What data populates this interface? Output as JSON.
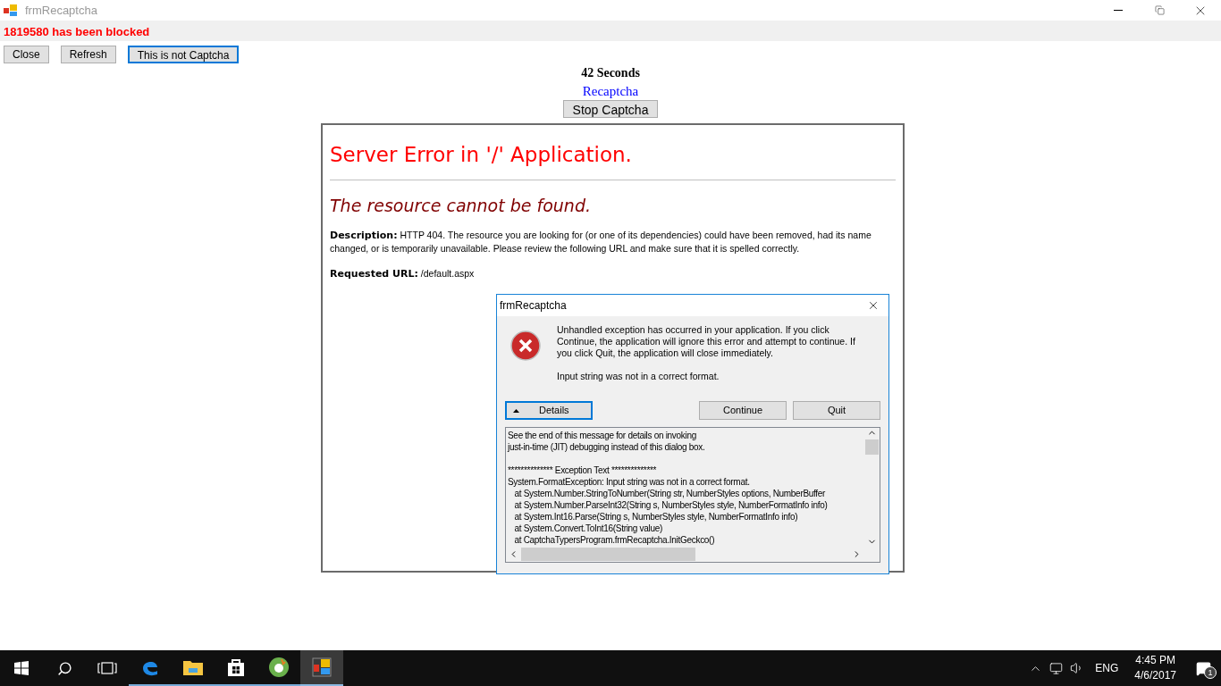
{
  "window": {
    "title": "frmRecaptcha"
  },
  "status_message": "1819580 has been blocked",
  "toolbar_buttons": [
    {
      "label": "Close",
      "focused": false
    },
    {
      "label": "Refresh",
      "focused": false
    },
    {
      "label": "This is not Captcha",
      "focused": true
    }
  ],
  "timer": "42 Seconds",
  "recaptcha_link": "Recaptcha",
  "stop_button": "Stop Captcha",
  "browser": {
    "heading": "Server Error in '/' Application.",
    "subheading": "The resource cannot be found.",
    "description_label": "Description:",
    "description": "HTTP 404. The resource you are looking for (or one of its dependencies) could have been removed, had its name changed, or is temporarily unavailable.  Please review the following URL and make sure that it is spelled correctly.",
    "url_label": "Requested URL:",
    "url": "/default.aspx"
  },
  "dialog": {
    "title": "frmRecaptcha",
    "message": "Unhandled exception has occurred in your application. If you click Continue, the application will ignore this error and attempt to continue. If you click Quit, the application will close immediately.",
    "detail_message": "Input string was not in a correct format.",
    "details_button": {
      "label": "Details",
      "expanded": true
    },
    "buttons": [
      "Continue",
      "Quit"
    ],
    "details_blocks": [
      [
        "See the end of this message for details on invoking",
        "just-in-time (JIT) debugging instead of this dialog box."
      ],
      [
        "************** Exception Text **************",
        "System.FormatException: Input string was not in a correct format.",
        "   at System.Number.StringToNumber(String str, NumberStyles options, NumberBuffer",
        "   at System.Number.ParseInt32(String s, NumberStyles style, NumberFormatInfo info)",
        "   at System.Int16.Parse(String s, NumberStyles style, NumberFormatInfo info)",
        "   at System.Convert.ToInt16(String value)",
        "   at CaptchaTypersProgram.frmRecaptcha.InitGeckco()"
      ]
    ]
  },
  "taskbar": {
    "apps": [
      {
        "kind": "edge",
        "active": false
      },
      {
        "kind": "explorer",
        "active": false
      },
      {
        "kind": "store",
        "active": false
      },
      {
        "kind": "green",
        "active": false
      },
      {
        "kind": "app",
        "active": true
      }
    ],
    "language": "ENG",
    "time": "4:45 PM",
    "date": "4/6/2017",
    "notification_count": "1"
  }
}
